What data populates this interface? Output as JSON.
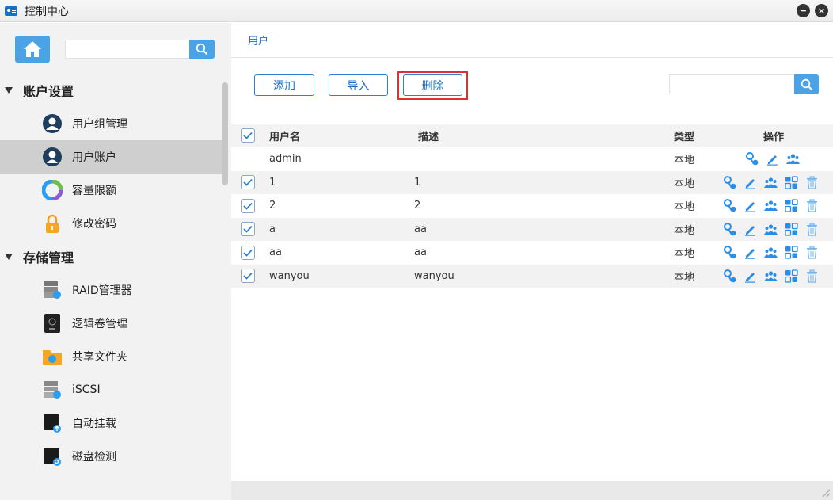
{
  "window": {
    "title": "控制中心",
    "buttons": [
      "−",
      "×"
    ]
  },
  "sidebar": {
    "search": {
      "placeholder": ""
    },
    "sections": [
      {
        "label": "账户设置",
        "items": [
          {
            "label": "用户组管理",
            "icon": "user-group-icon",
            "active": false
          },
          {
            "label": "用户账户",
            "icon": "user-account-icon",
            "active": true
          },
          {
            "label": "容量限额",
            "icon": "quota-pie-icon",
            "active": false
          },
          {
            "label": "修改密码",
            "icon": "lock-icon",
            "active": false
          }
        ]
      },
      {
        "label": "存储管理",
        "items": [
          {
            "label": "RAID管理器",
            "icon": "raid-icon",
            "active": false
          },
          {
            "label": "逻辑卷管理",
            "icon": "lvm-icon",
            "active": false
          },
          {
            "label": "共享文件夹",
            "icon": "shared-folder-icon",
            "active": false
          },
          {
            "label": "iSCSI",
            "icon": "iscsi-icon",
            "active": false
          },
          {
            "label": "自动挂载",
            "icon": "auto-mount-icon",
            "active": false
          },
          {
            "label": "磁盘检测",
            "icon": "disk-check-icon",
            "active": false
          }
        ]
      }
    ]
  },
  "main": {
    "breadcrumb": "用户",
    "toolbar": {
      "add_label": "添加",
      "import_label": "导入",
      "delete_label": "删除"
    },
    "search": {
      "placeholder": ""
    },
    "table": {
      "columns": [
        "用户名",
        "描述",
        "类型",
        "操作"
      ],
      "rows": [
        {
          "username": "admin",
          "description": "",
          "type": "本地",
          "checkbox": false,
          "ops": [
            "key-icon",
            "edit-icon",
            "group-icon"
          ]
        },
        {
          "username": "1",
          "description": "1",
          "type": "本地",
          "checkbox": true,
          "ops": [
            "key-icon",
            "edit-icon",
            "group-icon",
            "apps-icon",
            "trash-icon"
          ]
        },
        {
          "username": "2",
          "description": "2",
          "type": "本地",
          "checkbox": true,
          "ops": [
            "key-icon",
            "edit-icon",
            "group-icon",
            "apps-icon",
            "trash-icon"
          ]
        },
        {
          "username": "a",
          "description": "aa",
          "type": "本地",
          "checkbox": true,
          "ops": [
            "key-icon",
            "edit-icon",
            "group-icon",
            "apps-icon",
            "trash-icon"
          ]
        },
        {
          "username": "aa",
          "description": "aa",
          "type": "本地",
          "checkbox": true,
          "ops": [
            "key-icon",
            "edit-icon",
            "group-icon",
            "apps-icon",
            "trash-icon"
          ]
        },
        {
          "username": "wanyou",
          "description": "wanyou",
          "type": "本地",
          "checkbox": true,
          "ops": [
            "key-icon",
            "edit-icon",
            "group-icon",
            "apps-icon",
            "trash-icon"
          ]
        }
      ]
    }
  },
  "colors": {
    "accent": "#4aa3e6",
    "link": "#1a6fc4",
    "highlight_box": "#e03030"
  }
}
